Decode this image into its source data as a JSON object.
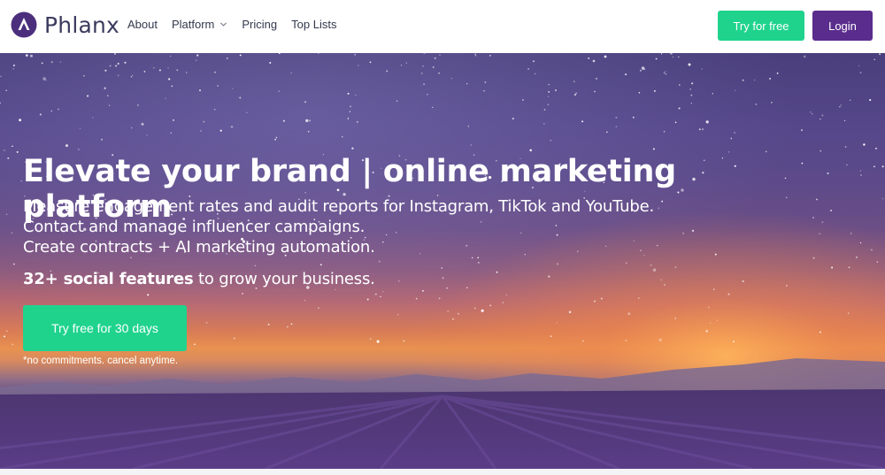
{
  "header": {
    "logo_text": "Phlanx",
    "nav": [
      {
        "label": "About"
      },
      {
        "label": "Platform"
      },
      {
        "label": "Pricing"
      },
      {
        "label": "Top Lists"
      }
    ],
    "try_label": "Try for free",
    "login_label": "Login"
  },
  "hero": {
    "title": "Elevate your brand | online marketing platform",
    "lines": [
      "Measure engagement rates and audit reports for Instagram, TikTok and YouTube.",
      "Contact and manage influencer campaigns.",
      "Create contracts + AI marketing automation."
    ],
    "features_bold": "32+ social features",
    "features_rest": " to grow your business.",
    "cta_label": "Try free for 30 days",
    "note": "*no commitments. cancel anytime."
  },
  "colors": {
    "accent_green": "#1fd38d",
    "brand_purple": "#5a2d8c"
  }
}
